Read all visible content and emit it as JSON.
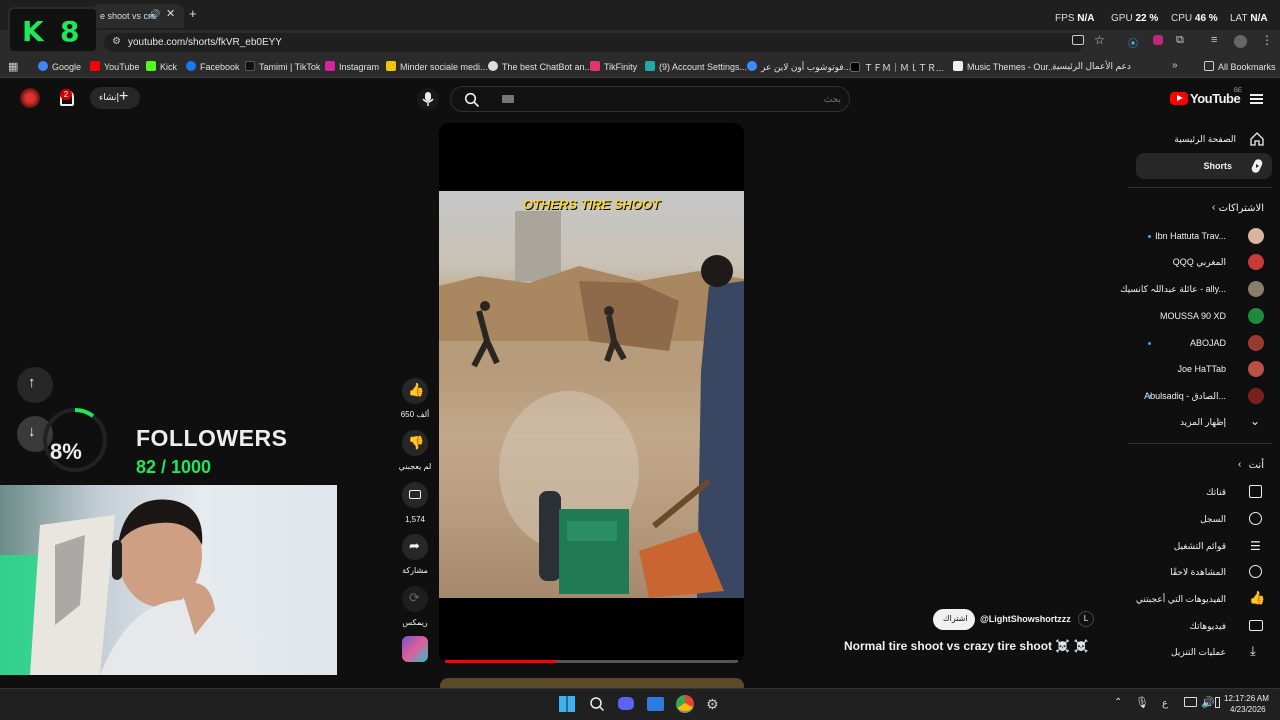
{
  "browser": {
    "tab_title": "e shoot vs cra",
    "url": "youtube.com/shorts/fkVR_eb0EYY",
    "bookmarks": [
      "Google",
      "YouTube",
      "Kick",
      "Facebook",
      "Tamimi | TikTok",
      "Instagram",
      "Minder sociale medi...",
      "The best ChatBot an...",
      "TikFinity",
      "(9) Account Settings...",
      "فوتوشوب أون لاين عر...",
      "ＴＦＭ｜ＭｌＴＲ...",
      "Music Themes - Our...",
      "دعم الأعمال الرئيسية"
    ],
    "all_bookmarks": "All Bookmarks"
  },
  "stats": {
    "fps_label": "FPS",
    "fps_value": "N/A",
    "gpu_label": "GPU",
    "gpu_value": "22 %",
    "cpu_label": "CPU",
    "cpu_value": "46 %",
    "lat_label": "LAT",
    "lat_value": "N/A"
  },
  "logo": {
    "k": "K",
    "n": "8"
  },
  "header": {
    "create_label": "إنشاء",
    "notif_count": "2",
    "search_placeholder": "بحث",
    "yt_logo": "YouTube",
    "region": "BE"
  },
  "sidebar": {
    "home": "الصفحة الرئيسية",
    "shorts": "Shorts",
    "subs_heading": "الاشتراكات",
    "subscriptions": [
      "Ibn Hattuta Trav...",
      "QQQ المغربي",
      "عائلة عبداللہ كانسيك - ally...",
      "MOUSSA 90 XD",
      "ABOJAD",
      "Joe HaTTab",
      "Abulsadiq - الصادق..."
    ],
    "show_more": "إظهار المزيد",
    "you_heading": "أنت",
    "you_items": [
      "قناتك",
      "السجل",
      "قوائم التشغيل",
      "المشاهدة لاحقًا",
      "الفيديوهات التي أعجبتني",
      "فيديوهاتك",
      "عمليات التنزيل"
    ]
  },
  "video": {
    "overlay_text": "OTHERS TIRE SHOOT",
    "channel": "@LightShowshortzzz",
    "subscribe_label": "اشتراك",
    "title": "Normal tire shoot vs crazy tire shoot ☠️ ☠️",
    "progress": 0.38
  },
  "actions": {
    "likes": "650 ألف",
    "dislike": "لم يعجبني",
    "comments": "1,574",
    "share": "مشاركة",
    "remix": "ريمكس"
  },
  "stream": {
    "percent": "8%",
    "followers_label": "FOLLOWERS",
    "followers_count": "82 / 1000"
  },
  "taskbar": {
    "time": "12:17:26 AM",
    "date": "4/23/2026",
    "lang": "ع"
  }
}
